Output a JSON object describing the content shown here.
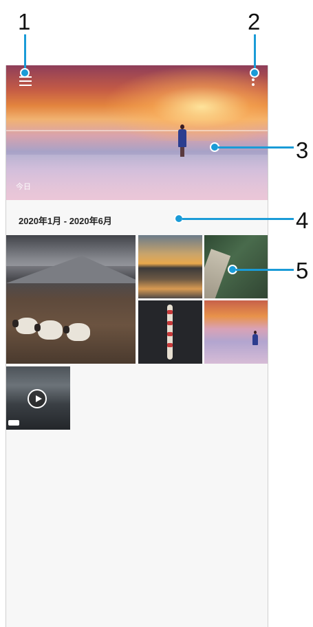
{
  "callouts": [
    "1",
    "2",
    "3",
    "4",
    "5"
  ],
  "colors": {
    "accent": "#1a9bd7",
    "background": "#f7f7f7"
  },
  "toolbar": {
    "menu_icon": "hamburger-menu-icon",
    "more_icon": "more-vert-icon"
  },
  "highlight": {
    "label": "今日"
  },
  "section": {
    "date_range": "2020年1月 - 2020年6月"
  },
  "grid": {
    "items": [
      {
        "type": "photo",
        "subject": "sheep"
      },
      {
        "type": "photo",
        "subject": "sunset"
      },
      {
        "type": "photo",
        "subject": "bridge"
      },
      {
        "type": "photo",
        "subject": "rowers"
      },
      {
        "type": "photo",
        "subject": "beach"
      },
      {
        "type": "video",
        "subject": "crowd",
        "icon": "play-icon"
      }
    ]
  }
}
